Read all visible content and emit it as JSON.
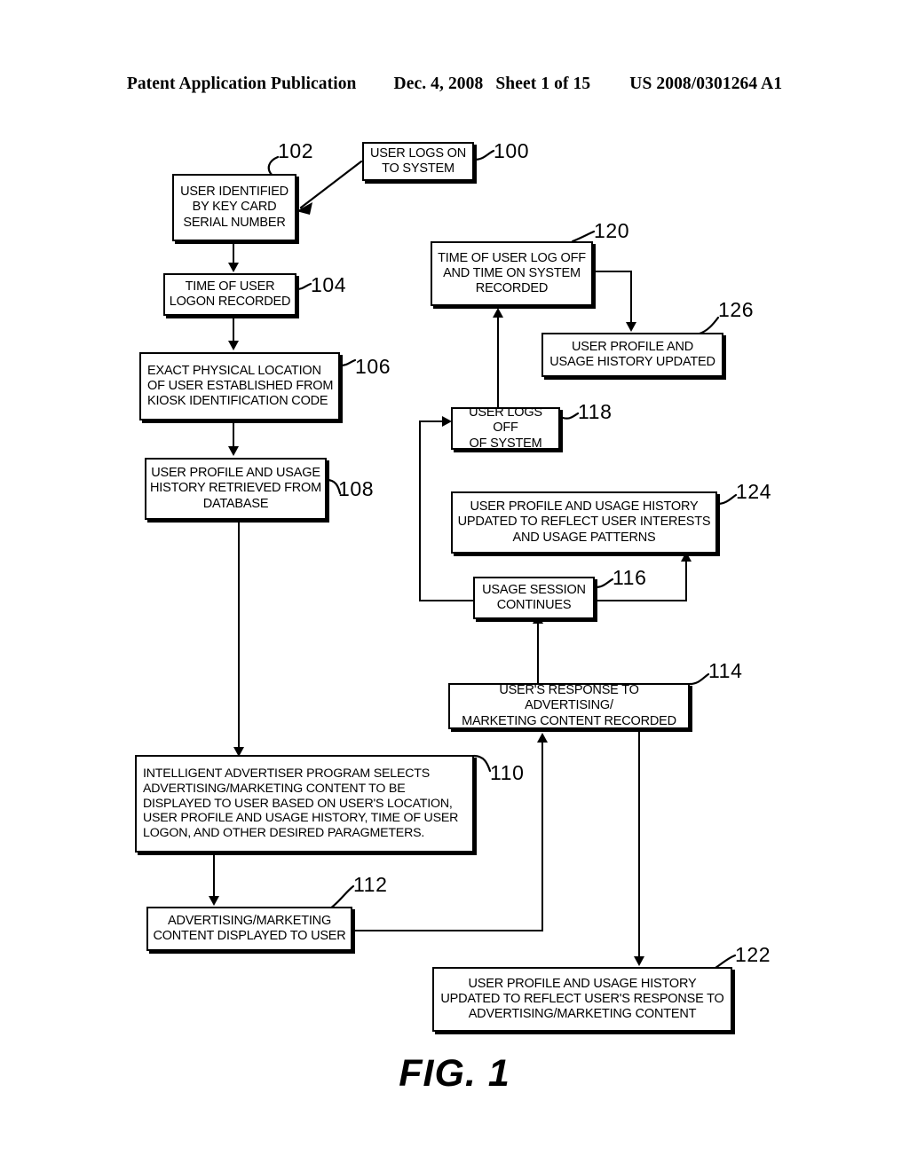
{
  "header": {
    "publication": "Patent Application Publication",
    "date": "Dec. 4, 2008",
    "sheet": "Sheet 1 of 15",
    "patent_number": "US 2008/0301264 A1"
  },
  "figure": {
    "caption": "FIG. 1",
    "type": "flowchart"
  },
  "diagram": {
    "nodes": [
      {
        "ref": "100",
        "text": "USER LOGS ON TO SYSTEM",
        "lines": [
          "USER LOGS ON",
          "TO SYSTEM"
        ]
      },
      {
        "ref": "102",
        "text": "USER IDENTIFIED BY KEY CARD SERIAL NUMBER",
        "lines": [
          "USER IDENTIFIED",
          "BY KEY CARD",
          "SERIAL NUMBER"
        ]
      },
      {
        "ref": "104",
        "text": "TIME OF USER LOGON RECORDED",
        "lines": [
          "TIME OF USER",
          "LOGON RECORDED"
        ]
      },
      {
        "ref": "106",
        "text": "EXACT PHYSICAL LOCATION OF USER ESTABLISHED FROM KIOSK IDENTIFICATION CODE",
        "lines": [
          "EXACT PHYSICAL LOCATION",
          "OF USER ESTABLISHED FROM",
          "KIOSK IDENTIFICATION CODE"
        ]
      },
      {
        "ref": "108",
        "text": "USER PROFILE AND USAGE HISTORY RETRIEVED FROM DATABASE",
        "lines": [
          "USER PROFILE AND USAGE",
          "HISTORY RETRIEVED FROM",
          "DATABASE"
        ]
      },
      {
        "ref": "110",
        "text": "INTELLIGENT ADVERTISER PROGRAM SELECTS ADVERTISING/MARKETING CONTENT TO BE DISPLAYED TO USER BASED ON USER'S LOCATION, USER PROFILE AND USAGE HISTORY, TIME OF USER LOGON, AND OTHER DESIRED PARAGMETERS.",
        "lines": [
          "INTELLIGENT ADVERTISER PROGRAM SELECTS",
          "ADVERTISING/MARKETING CONTENT TO BE",
          "DISPLAYED TO USER BASED ON USER'S LOCATION,",
          "USER PROFILE AND USAGE HISTORY, TIME OF USER",
          "LOGON, AND OTHER DESIRED PARAGMETERS."
        ]
      },
      {
        "ref": "112",
        "text": "ADVERTISING/MARKETING CONTENT DISPLAYED TO USER",
        "lines": [
          "ADVERTISING/MARKETING",
          "CONTENT DISPLAYED TO USER"
        ]
      },
      {
        "ref": "114",
        "text": "USER'S RESPONSE TO ADVERTISING/ MARKETING CONTENT RECORDED",
        "lines": [
          "USER'S RESPONSE TO ADVERTISING/",
          "MARKETING CONTENT RECORDED"
        ]
      },
      {
        "ref": "116",
        "text": "USAGE SESSION CONTINUES",
        "lines": [
          "USAGE SESSION",
          "CONTINUES"
        ]
      },
      {
        "ref": "118",
        "text": "USER LOGS OFF OF SYSTEM",
        "lines": [
          "USER LOGS OFF",
          "OF SYSTEM"
        ]
      },
      {
        "ref": "120",
        "text": "TIME OF USER LOG OFF AND TIME ON SYSTEM RECORDED",
        "lines": [
          "TIME OF USER LOG OFF",
          "AND TIME ON SYSTEM",
          "RECORDED"
        ]
      },
      {
        "ref": "122",
        "text": "USER PROFILE AND USAGE HISTORY UPDATED TO REFLECT USER'S RESPONSE TO ADVERTISING/MARKETING CONTENT",
        "lines": [
          "USER PROFILE AND USAGE HISTORY",
          "UPDATED TO REFLECT USER'S RESPONSE TO",
          "ADVERTISING/MARKETING CONTENT"
        ]
      },
      {
        "ref": "124",
        "text": "USER PROFILE AND USAGE HISTORY UPDATED TO REFLECT USER INTERESTS AND USAGE PATTERNS",
        "lines": [
          "USER PROFILE AND USAGE HISTORY",
          "UPDATED TO REFLECT USER INTERESTS",
          "AND USAGE PATTERNS"
        ]
      },
      {
        "ref": "126",
        "text": "USER PROFILE AND USAGE HISTORY UPDATED",
        "lines": [
          "USER PROFILE AND",
          "USAGE HISTORY UPDATED"
        ]
      }
    ],
    "reference_numerals": [
      "100",
      "102",
      "104",
      "106",
      "108",
      "110",
      "112",
      "114",
      "116",
      "118",
      "120",
      "122",
      "124",
      "126"
    ],
    "edges": [
      {
        "from": "100",
        "to": "102"
      },
      {
        "from": "102",
        "to": "104"
      },
      {
        "from": "104",
        "to": "106"
      },
      {
        "from": "106",
        "to": "108"
      },
      {
        "from": "108",
        "to": "110"
      },
      {
        "from": "110",
        "to": "112"
      },
      {
        "from": "112",
        "to": "114"
      },
      {
        "from": "114",
        "to": "116"
      },
      {
        "from": "114",
        "to": "122"
      },
      {
        "from": "116",
        "to": "124"
      },
      {
        "from": "116",
        "to": "118"
      },
      {
        "from": "118",
        "to": "120"
      },
      {
        "from": "120",
        "to": "126"
      }
    ]
  },
  "colors": {
    "ink": "#000000",
    "paper": "#ffffff"
  }
}
